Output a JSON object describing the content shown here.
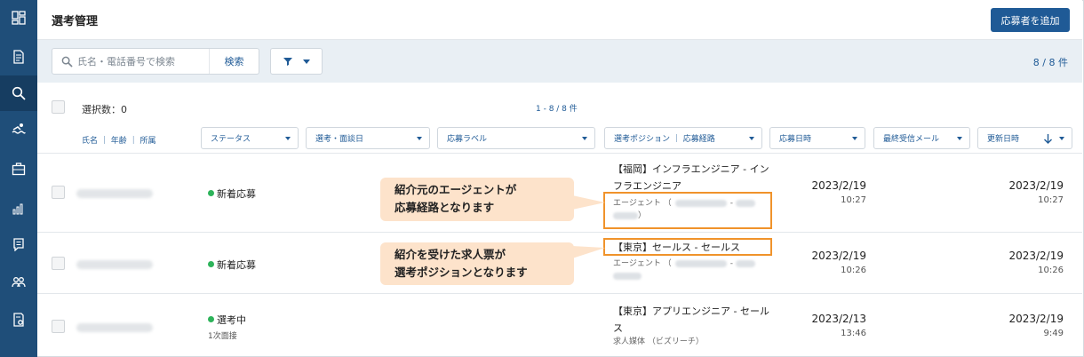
{
  "app": {
    "title": "選考管理",
    "add_button": "応募者を追加"
  },
  "sidebar": {
    "items": [
      {
        "icon": "dashboard-icon"
      },
      {
        "icon": "document-edit-icon"
      },
      {
        "icon": "search-icon"
      },
      {
        "icon": "swimmer-icon"
      },
      {
        "icon": "briefcase-icon"
      },
      {
        "icon": "bar-chart-icon"
      },
      {
        "icon": "messages-icon"
      },
      {
        "icon": "users-icon"
      },
      {
        "icon": "document-settings-icon"
      }
    ]
  },
  "search": {
    "placeholder": "氏名・電話番号で検索",
    "button": "検索",
    "count": "8 / 8 件"
  },
  "list": {
    "selected_label": "選択数：0",
    "range": "1 - 8 / 8 件",
    "name_header": "氏名 ｜ 年齢 ｜ 所属",
    "columns": [
      "ステータス",
      "選考・面談日",
      "応募ラベル",
      "選考ポジション ｜ 応募経路",
      "応募日時",
      "最終受信メール",
      "更新日時"
    ]
  },
  "rows": [
    {
      "status": "新着応募",
      "substatus": "",
      "position": "【福岡】インフラエンジニア - インフラエンジニア",
      "route": "エージェント （",
      "route_end": "）",
      "applied_date": "2023/2/19",
      "applied_time": "10:27",
      "updated_date": "2023/2/19",
      "updated_time": "10:27"
    },
    {
      "status": "新着応募",
      "substatus": "",
      "position": "【東京】セールス - セールス",
      "route": "エージェント （",
      "route_end": "",
      "applied_date": "2023/2/19",
      "applied_time": "10:26",
      "updated_date": "2023/2/19",
      "updated_time": "10:26"
    },
    {
      "status": "選考中",
      "substatus": "1次面接",
      "position": "【東京】アプリエンジニア - セールス",
      "route": "求人媒体 （ビズリーチ）",
      "route_end": "",
      "applied_date": "2023/2/13",
      "applied_time": "13:46",
      "updated_date": "2023/2/19",
      "updated_time": "9:49"
    }
  ],
  "annotations": {
    "callout1_line1": "紹介元のエージェントが",
    "callout1_line2": "応募経路となります",
    "callout2_line1": "紹介を受けた求人票が",
    "callout2_line2": "選考ポジションとなります"
  },
  "colors": {
    "sidebar": "#1f4e79",
    "accent": "#1f5a96",
    "highlight": "#f0932b",
    "callout": "#fde3cb",
    "status_dot": "#2db35a"
  }
}
